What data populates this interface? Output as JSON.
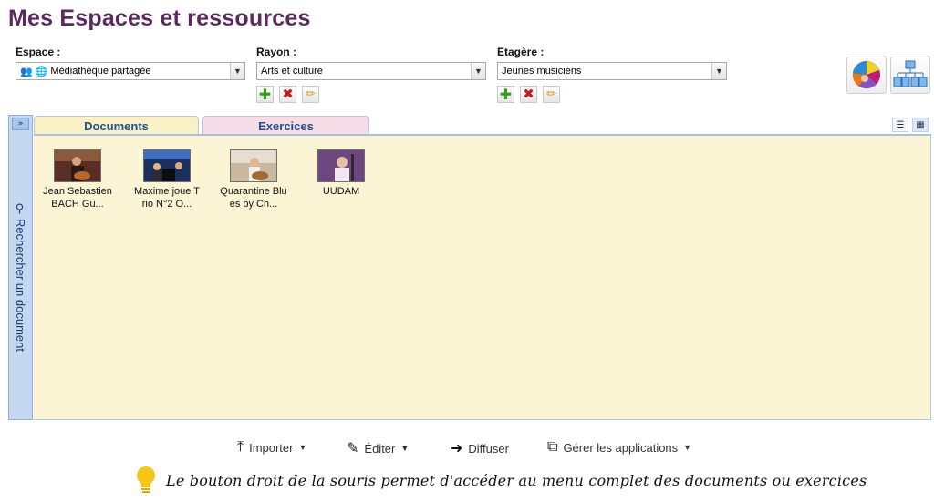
{
  "page": {
    "title": "Mes Espaces et ressources"
  },
  "filters": {
    "espace": {
      "label": "Espace :",
      "value": "Médiathèque partagée",
      "icons": [
        "people-icon",
        "globe-icon"
      ]
    },
    "rayon": {
      "label": "Rayon :",
      "value": "Arts et culture"
    },
    "etagere": {
      "label": "Etagère :",
      "value": "Jeunes musiciens"
    }
  },
  "side_panel": {
    "label": "Rechercher un document",
    "expand_glyph": "»"
  },
  "tabs": [
    {
      "label": "Documents",
      "active": true,
      "color": "#f9f1c5"
    },
    {
      "label": "Exercices",
      "active": false,
      "color": "#f6dde8"
    }
  ],
  "documents": [
    {
      "line1": "Jean Sebastien",
      "line2": "BACH Gu..."
    },
    {
      "line1": "Maxime joue T",
      "line2": "rio N°2 O..."
    },
    {
      "line1": "Quarantine Blu",
      "line2": "es by Ch..."
    },
    {
      "line1": "UUDAM",
      "line2": ""
    }
  ],
  "actions": {
    "importer": "Importer",
    "editer": "Éditer",
    "diffuser": "Diffuser",
    "gerer": "Gérer les applications"
  },
  "tip": {
    "text": "Le bouton droit de la souris permet d'accéder au menu complet des documents ou exercices"
  },
  "colors": {
    "title": "#5a2a5e",
    "side_panel": "#c4d8f2",
    "content_bg": "#fbf5d6",
    "tab_text": "#27508a"
  }
}
